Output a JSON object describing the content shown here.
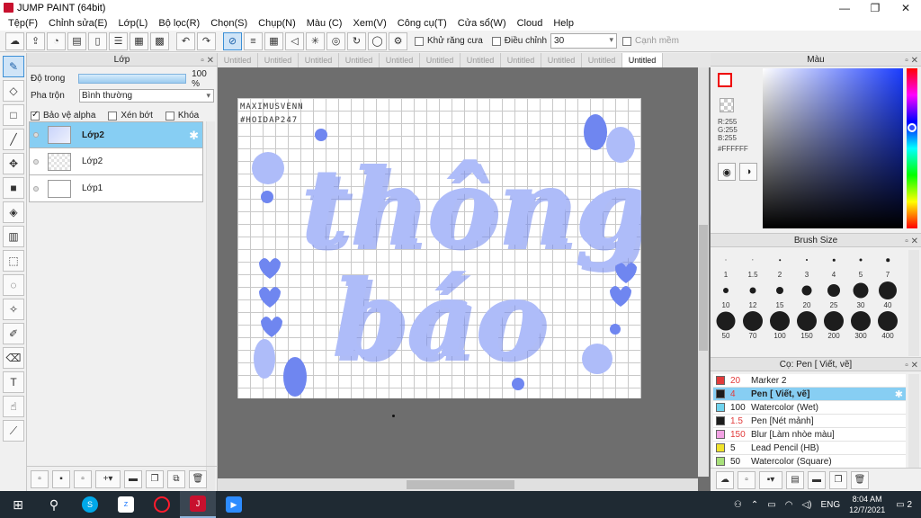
{
  "window": {
    "title": "JUMP PAINT (64bit)",
    "controls": [
      "—",
      "❐",
      "✕"
    ]
  },
  "menu": [
    "Tệp(F)",
    "Chỉnh sửa(E)",
    "Lớp(L)",
    "Bộ lọc(R)",
    "Chọn(S)",
    "Chụp(N)",
    "Màu (C)",
    "Xem(V)",
    "Công cụ(T)",
    "Cửa sổ(W)",
    "Cloud",
    "Help"
  ],
  "toolbar": {
    "antialias_label": "Khử răng cưa",
    "adjust_label": "Điều chỉnh",
    "adjust_value": "30",
    "edge_label": "Cạnh mềm"
  },
  "layer_panel": {
    "title": "Lớp",
    "opacity_label": "Độ trong",
    "opacity_value": "100 %",
    "opacity_fraction": 1.0,
    "blend_label": "Pha trộn",
    "blend_value": "Bình thường",
    "protect_alpha": "Bảo vệ alpha",
    "clip": "Xén bớt",
    "lock": "Khóa",
    "layers": [
      {
        "name": "Lớp2",
        "active": true
      },
      {
        "name": "Lớp2",
        "active": false
      },
      {
        "name": "Lớp1",
        "active": false
      }
    ]
  },
  "tabs": [
    "Untitled",
    "Untitled",
    "Untitled",
    "Untitled",
    "Untitled",
    "Untitled",
    "Untitled",
    "Untitled",
    "Untitled",
    "Untitled",
    "Untitled"
  ],
  "artwork": {
    "credit_line1": "MAXIMUSVENN",
    "credit_line2": "#HOIDAP247",
    "word1": "thông",
    "word2": "báo",
    "ink_color": "#6f86f0",
    "fill_color": "#aebcf9"
  },
  "color_panel": {
    "title": "Màu",
    "r": "R:255",
    "g": "G:255",
    "b": "B:255",
    "hex": "#FFFFFF"
  },
  "brush_panel": {
    "title": "Brush Size",
    "sizes": [
      "1",
      "1.5",
      "2",
      "3",
      "4",
      "5",
      "7",
      "10",
      "12",
      "15",
      "20",
      "25",
      "30",
      "40",
      "50",
      "70",
      "100",
      "150",
      "200",
      "300",
      "400"
    ]
  },
  "pen_panel": {
    "title": "Cọ: Pen [ Viết, vẽ]",
    "tools": [
      {
        "size": "20",
        "name": "Marker 2",
        "color": "#e23b3b",
        "size_color": "#e23b3b",
        "active": false
      },
      {
        "size": "4",
        "name": "Pen [ Viết, vẽ]",
        "color": "#1c1c1c",
        "size_color": "#e23b3b",
        "active": true
      },
      {
        "size": "100",
        "name": "Watercolor (Wet)",
        "color": "#6fd3ee",
        "size_color": "#222222",
        "active": false
      },
      {
        "size": "1.5",
        "name": "Pen [Nét mảnh]",
        "color": "#1c1c1c",
        "size_color": "#e23b3b",
        "active": false
      },
      {
        "size": "150",
        "name": "Blur [Làm nhòe màu]",
        "color": "#f2a2e4",
        "size_color": "#e23b3b",
        "active": false
      },
      {
        "size": "5",
        "name": "Lead Pencil (HB)",
        "color": "#f0e22a",
        "size_color": "#222222",
        "active": false
      },
      {
        "size": "50",
        "name": "Watercolor (Square)",
        "color": "#a8e07a",
        "size_color": "#222222",
        "active": false
      }
    ]
  },
  "taskbar": {
    "lang": "ENG",
    "time": "8:04 AM",
    "date": "12/7/2021",
    "notifications": "2"
  }
}
